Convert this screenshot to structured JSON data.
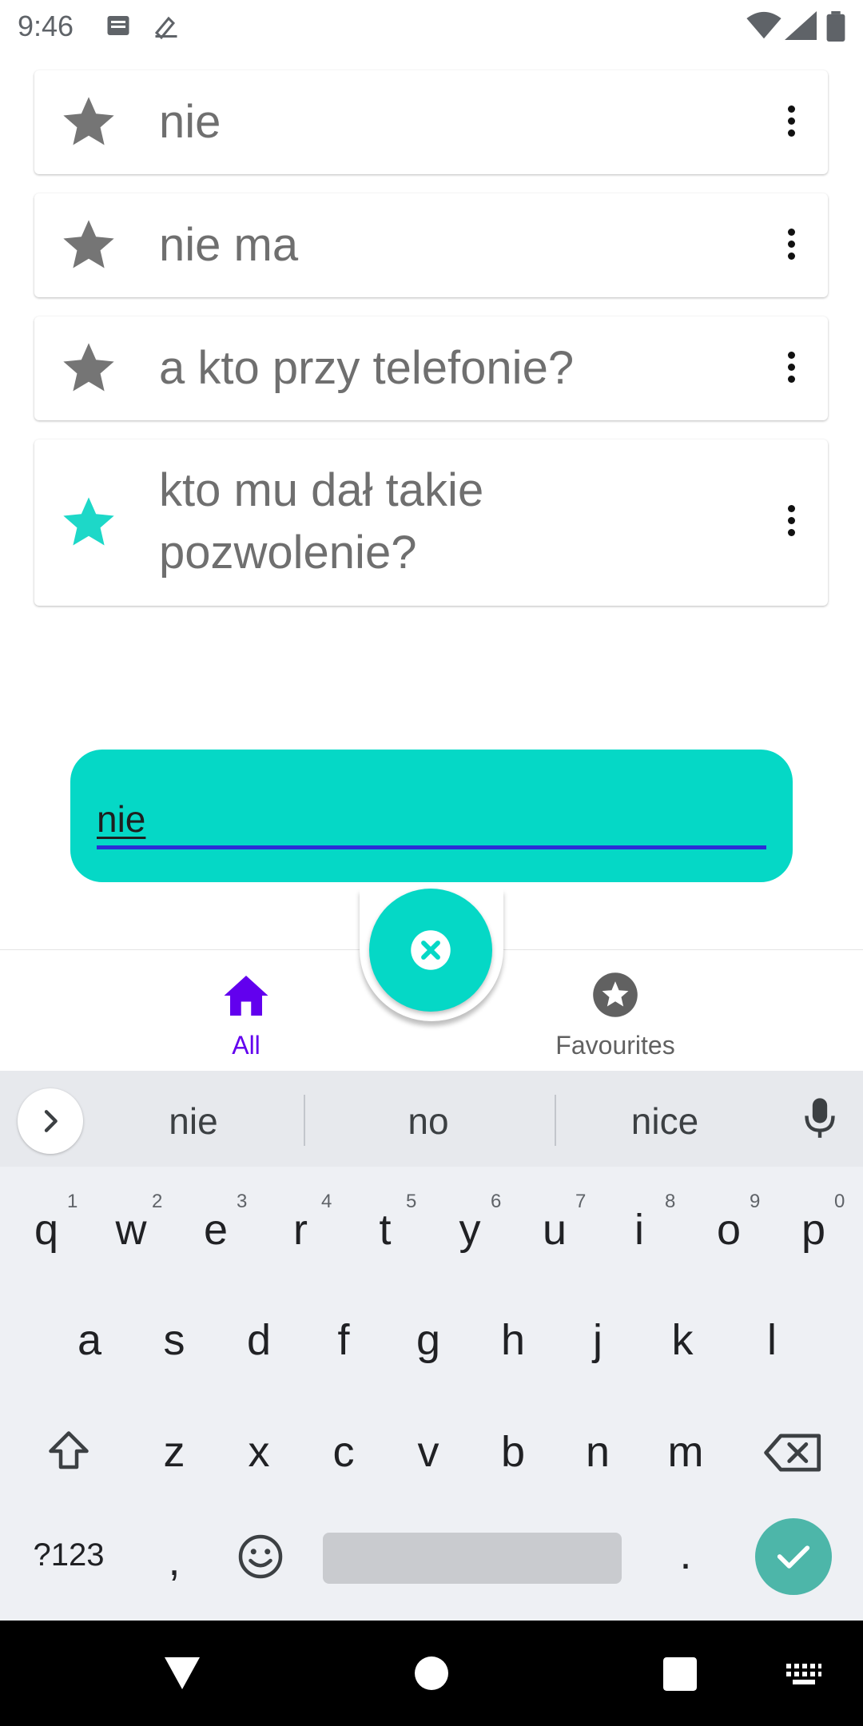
{
  "status_bar": {
    "time": "9:46"
  },
  "phrases": [
    {
      "text": "nie",
      "favourite": false
    },
    {
      "text": "nie ma",
      "favourite": false
    },
    {
      "text": "a kto przy telefonie?",
      "favourite": false
    },
    {
      "text": "kto mu dał takie pozwolenie?",
      "favourite": true
    }
  ],
  "search": {
    "value": "nie"
  },
  "bottom_nav": {
    "all_label": "All",
    "favourites_label": "Favourites"
  },
  "keyboard": {
    "suggestions": [
      "nie",
      "no",
      "nice"
    ],
    "row1": [
      "q",
      "w",
      "e",
      "r",
      "t",
      "y",
      "u",
      "i",
      "o",
      "p"
    ],
    "row1_hints": [
      "1",
      "2",
      "3",
      "4",
      "5",
      "6",
      "7",
      "8",
      "9",
      "0"
    ],
    "row2": [
      "a",
      "s",
      "d",
      "f",
      "g",
      "h",
      "j",
      "k",
      "l"
    ],
    "row3": [
      "z",
      "x",
      "c",
      "v",
      "b",
      "n",
      "m"
    ],
    "symbols_label": "?123",
    "comma": ",",
    "period": "."
  },
  "colors": {
    "accent": "#05d8c6",
    "nav_active": "#6200ee",
    "star_default": "#757575",
    "star_favourite": "#1dd8c8"
  }
}
